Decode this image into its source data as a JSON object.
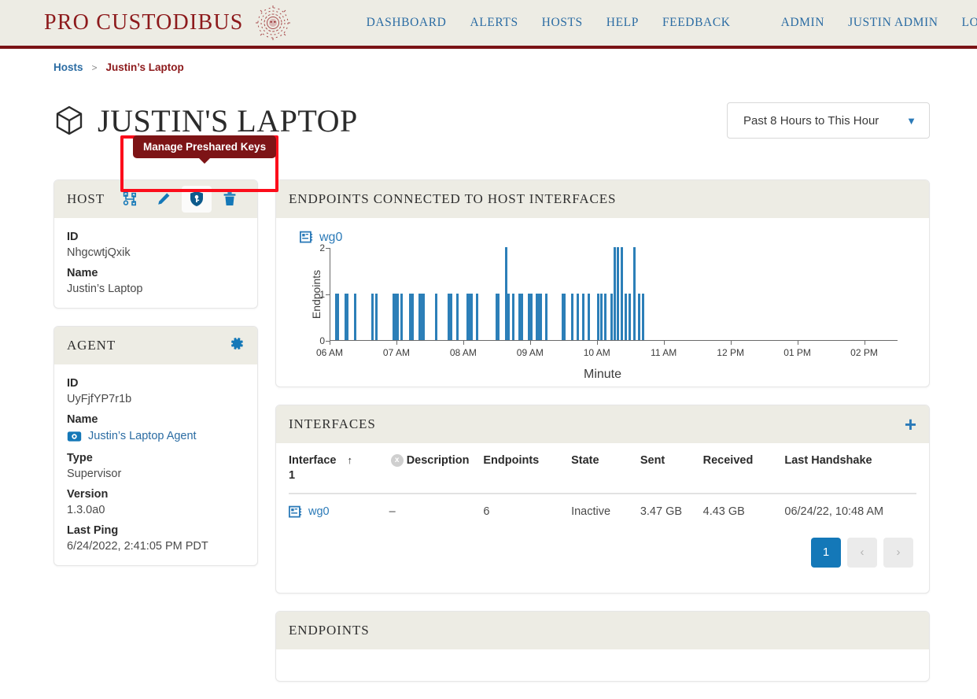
{
  "header": {
    "brand": "PRO CUSTODIBUS",
    "brand_icon": "medusa-logo-icon",
    "nav_primary": [
      {
        "label": "DASHBOARD"
      },
      {
        "label": "ALERTS"
      },
      {
        "label": "HOSTS"
      },
      {
        "label": "HELP"
      },
      {
        "label": "FEEDBACK"
      }
    ],
    "nav_secondary": [
      {
        "label": "ADMIN"
      },
      {
        "label": "JUSTIN ADMIN"
      },
      {
        "label": "LOG OUT"
      }
    ],
    "accent_color": "#7a1315",
    "link_color": "#2b6ca3"
  },
  "breadcrumb": {
    "parent": "Hosts",
    "separator": ">",
    "current": "Justin’s Laptop"
  },
  "page": {
    "title": "JUSTIN'S LAPTOP",
    "title_icon": "cube-icon",
    "range_selector": {
      "value": "Past 8 Hours to This Hour",
      "chevron": "chevron-down-icon"
    }
  },
  "tooltip": {
    "text": "Manage Preshared Keys",
    "background": "#7d1416",
    "highlight_color": "#fc0d1b"
  },
  "host_card": {
    "title": "HOST",
    "tools": [
      {
        "name": "network-fork-icon",
        "title": "Connections"
      },
      {
        "name": "pencil-edit-icon",
        "title": "Edit"
      },
      {
        "name": "shield-key-icon",
        "title": "Manage Preshared Keys",
        "active": true
      },
      {
        "name": "trash-delete-icon",
        "title": "Delete"
      }
    ],
    "fields": [
      {
        "label": "ID",
        "value": "NhgcwtjQxik"
      },
      {
        "label": "Name",
        "value": "Justin’s Laptop"
      }
    ]
  },
  "agent_card": {
    "title": "AGENT",
    "settings_icon": "gear-icon",
    "fields": [
      {
        "label": "ID",
        "value": "UyFjfYP7r1b",
        "type": "text"
      },
      {
        "label": "Name",
        "value": "Justin’s Laptop Agent",
        "type": "link",
        "icon": "agent-icon"
      },
      {
        "label": "Type",
        "value": "Supervisor",
        "type": "text"
      },
      {
        "label": "Version",
        "value": "1.3.0a0",
        "type": "text"
      },
      {
        "label": "Last Ping",
        "value": "6/24/2022, 2:41:05 PM PDT",
        "type": "text"
      }
    ]
  },
  "chart_card": {
    "title": "ENDPOINTS CONNECTED TO HOST INTERFACES",
    "legend_label": "wg0",
    "legend_icon": "interface-card-icon"
  },
  "chart_data": {
    "type": "bar",
    "title": "",
    "xlabel": "Minute",
    "ylabel": "Endpoints",
    "ylim": [
      0,
      2
    ],
    "yticks": [
      0,
      1,
      2
    ],
    "xlim": [
      6.0,
      14.5
    ],
    "xticks": [
      6,
      7,
      8,
      9,
      10,
      11,
      12,
      13,
      14
    ],
    "xticklabels": [
      "06 AM",
      "07 AM",
      "08 AM",
      "09 AM",
      "10 AM",
      "11 AM",
      "12 PM",
      "01 PM",
      "02 PM"
    ],
    "grid": false,
    "legend": "wg0",
    "bar_color": "#2c7fb8",
    "series": [
      {
        "name": "wg0",
        "x": [
          6.08,
          6.11,
          6.22,
          6.25,
          6.36,
          6.62,
          6.68,
          6.94,
          6.97,
          7.0,
          7.06,
          7.19,
          7.22,
          7.33,
          7.36,
          7.39,
          7.58,
          7.77,
          7.8,
          7.89,
          8.05,
          8.08,
          8.11,
          8.19,
          8.48,
          8.51,
          8.62,
          8.66,
          8.73,
          8.83,
          8.86,
          8.97,
          9.0,
          9.08,
          9.11,
          9.14,
          9.22,
          9.47,
          9.5,
          9.61,
          9.7,
          9.78,
          9.86,
          10.0,
          10.05,
          10.11,
          10.2,
          10.25,
          10.3,
          10.36,
          10.42,
          10.47,
          10.55,
          10.61,
          10.67
        ],
        "values": [
          1,
          1,
          1,
          1,
          1,
          1,
          1,
          1,
          1,
          1,
          1,
          1,
          1,
          1,
          1,
          1,
          1,
          1,
          1,
          1,
          1,
          1,
          1,
          1,
          1,
          1,
          2,
          1,
          1,
          1,
          1,
          1,
          1,
          1,
          1,
          1,
          1,
          1,
          1,
          1,
          1,
          1,
          1,
          1,
          1,
          1,
          1,
          2,
          2,
          2,
          1,
          1,
          2,
          1,
          1
        ]
      }
    ]
  },
  "interfaces_card": {
    "title": "INTERFACES",
    "add_icon": "plus-icon",
    "columns": [
      {
        "label": "Interface",
        "sort": "ascending",
        "sort_arrow": "↑",
        "sort_order": "1",
        "clear_sort": "x"
      },
      {
        "label": "Description"
      },
      {
        "label": "Endpoints"
      },
      {
        "label": "State"
      },
      {
        "label": "Sent"
      },
      {
        "label": "Received"
      },
      {
        "label": "Last Handshake"
      }
    ],
    "rows": [
      {
        "interface": "wg0",
        "interface_icon": "interface-card-icon",
        "description": "–",
        "endpoints": "6",
        "state": "Inactive",
        "sent": "3.47 GB",
        "received": "4.43 GB",
        "last_handshake": "06/24/22, 10:48 AM"
      }
    ],
    "pagination": {
      "current": "1",
      "prev": "‹",
      "next": "›"
    }
  },
  "endpoints_card": {
    "title": "ENDPOINTS"
  }
}
